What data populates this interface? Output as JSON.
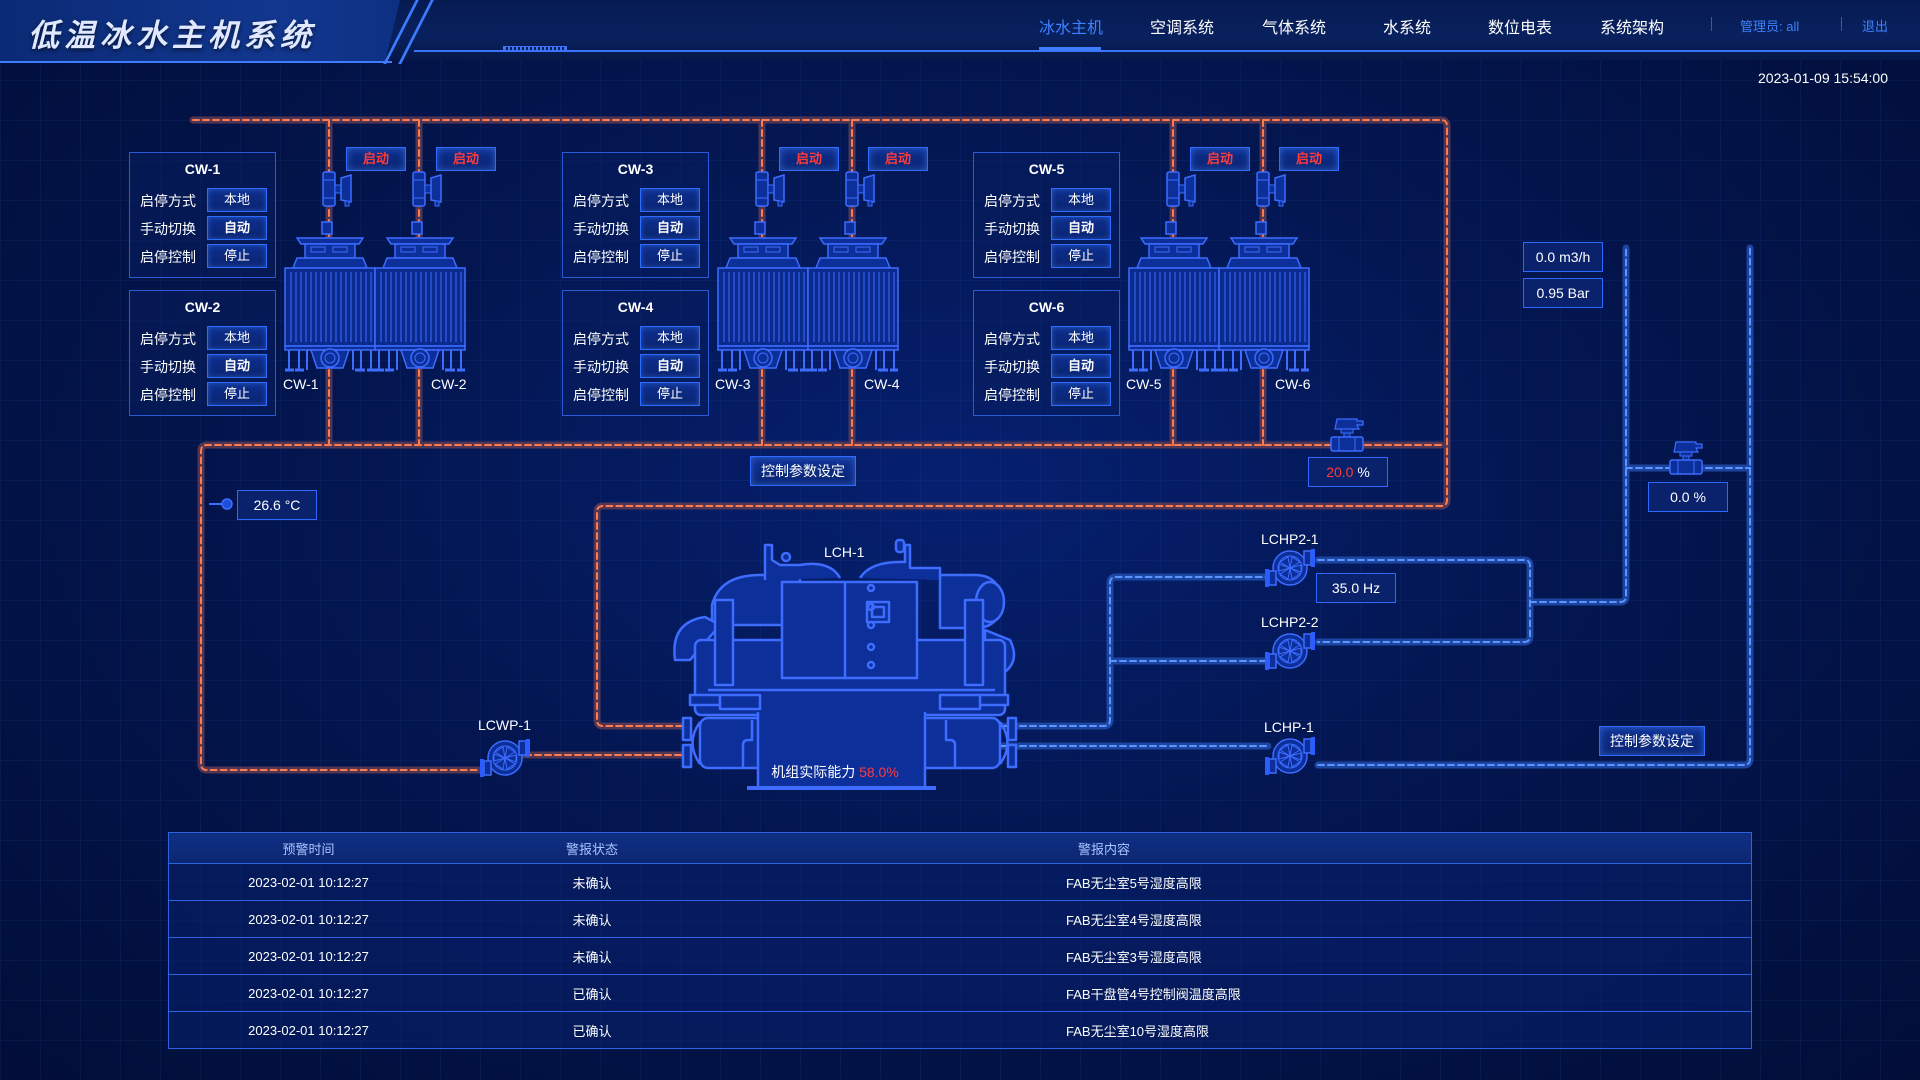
{
  "header": {
    "title": "低温冰水主机系统",
    "nav": [
      {
        "label": "冰水主机",
        "active": true
      },
      {
        "label": "空调系统",
        "active": false
      },
      {
        "label": "气体系统",
        "active": false
      },
      {
        "label": "水系统",
        "active": false
      },
      {
        "label": "数位电表",
        "active": false
      },
      {
        "label": "系统架构",
        "active": false
      }
    ],
    "admin_label": "管理员: all",
    "logout_label": "退出",
    "datetime": "2023-01-09  15:54:00"
  },
  "colors": {
    "accent": "#3d7bff",
    "alarm_red": "#ff3b3b",
    "ok_green": "#37e64b",
    "hot_pipe": "#ff7a4d",
    "cold_pipe": "#5b93ff"
  },
  "towers": [
    {
      "name": "CW-1",
      "start_label": "启动",
      "mode_label": "启停方式",
      "mode_value": "本地",
      "switch_label": "手动切换",
      "switch_value": "自动",
      "control_label": "启停控制",
      "control_value": "停止"
    },
    {
      "name": "CW-2",
      "start_label": "启动",
      "mode_label": "启停方式",
      "mode_value": "本地",
      "switch_label": "手动切换",
      "switch_value": "自动",
      "control_label": "启停控制",
      "control_value": "停止"
    },
    {
      "name": "CW-3",
      "start_label": "启动",
      "mode_label": "启停方式",
      "mode_value": "本地",
      "switch_label": "手动切换",
      "switch_value": "自动",
      "control_label": "启停控制",
      "control_value": "停止"
    },
    {
      "name": "CW-4",
      "start_label": "启动",
      "mode_label": "启停方式",
      "mode_value": "本地",
      "switch_label": "手动切换",
      "switch_value": "自动",
      "control_label": "启停控制",
      "control_value": "停止"
    },
    {
      "name": "CW-5",
      "start_label": "启动",
      "mode_label": "启停方式",
      "mode_value": "本地",
      "switch_label": "手动切换",
      "switch_value": "自动",
      "control_label": "启停控制",
      "control_value": "停止"
    },
    {
      "name": "CW-6",
      "start_label": "启动",
      "mode_label": "启停方式",
      "mode_value": "本地",
      "switch_label": "手动切换",
      "switch_value": "自动",
      "control_label": "启停控制",
      "control_value": "停止"
    }
  ],
  "readings": {
    "cooling_temp": "26.6 °C",
    "cooling_valve_value": "20.0",
    "cooling_valve_unit": " %",
    "flow": "0.0  m3/h",
    "pressure": "0.95  Bar",
    "bypass_valve": "0.0  %",
    "pump_freq": "35.0  Hz"
  },
  "params_button_label": "控制参数设定",
  "chiller": {
    "name": "LCH-1",
    "capacity_label": "机组实际能力",
    "capacity_value": "58.0%"
  },
  "pumps": {
    "lcwp1": "LCWP-1",
    "lchp21": "LCHP2-1",
    "lchp22": "LCHP2-2",
    "lchp1": "LCHP-1"
  },
  "alarms": {
    "headers": [
      "预警时间",
      "警报状态",
      "警报内容"
    ],
    "rows": [
      {
        "time": "2023-02-01  10:12:27",
        "status": "未确认",
        "status_type": "red",
        "content": "FAB无尘室5号湿度高限"
      },
      {
        "time": "2023-02-01  10:12:27",
        "status": "未确认",
        "status_type": "red",
        "content": "FAB无尘室4号湿度高限"
      },
      {
        "time": "2023-02-01  10:12:27",
        "status": "未确认",
        "status_type": "red",
        "content": "FAB无尘室3号湿度高限"
      },
      {
        "time": "2023-02-01  10:12:27",
        "status": "已确认",
        "status_type": "green",
        "content": "FAB干盘管4号控制阀温度高限"
      },
      {
        "time": "2023-02-01  10:12:27",
        "status": "已确认",
        "status_type": "green",
        "content": "FAB无尘室10号湿度高限"
      }
    ]
  }
}
